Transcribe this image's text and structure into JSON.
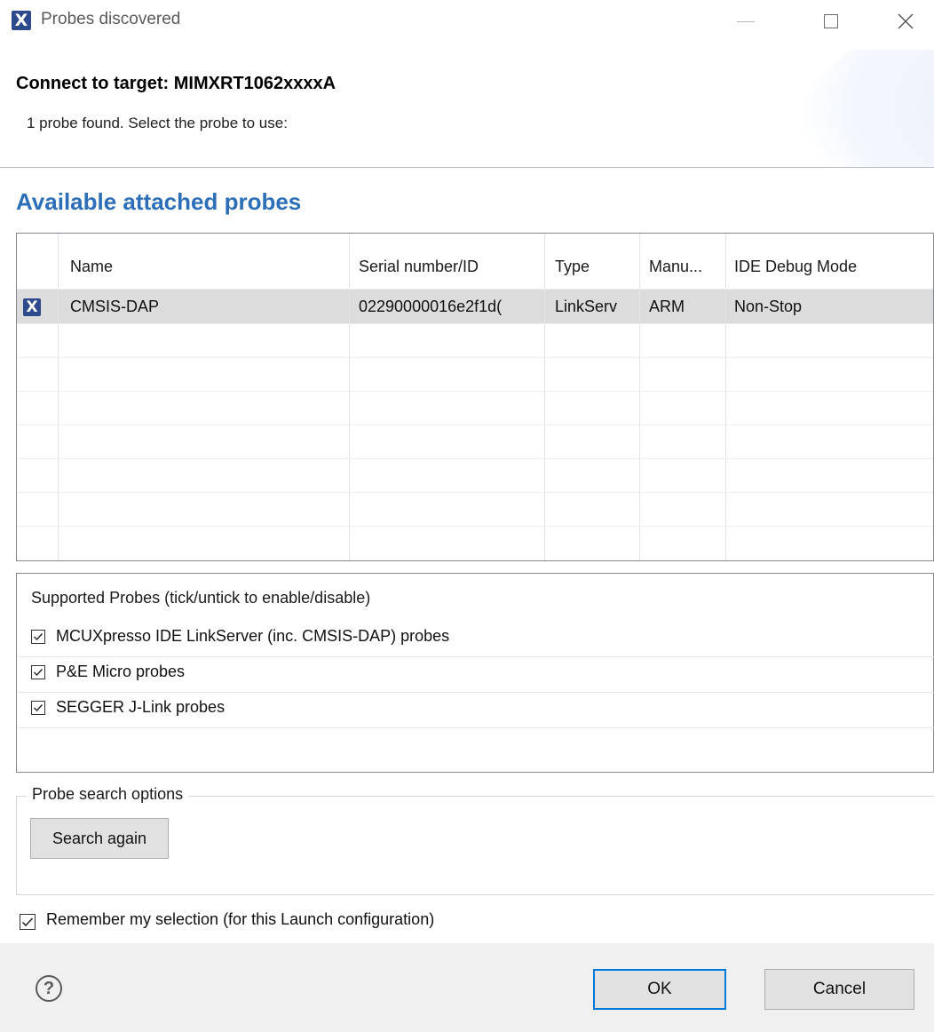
{
  "window": {
    "title": "Probes discovered",
    "app_icon_glyph": "X"
  },
  "header": {
    "title": "Connect to target: MIMXRT1062xxxxA",
    "description": "1 probe found. Select the probe to use:"
  },
  "probes_section": {
    "heading": "Available attached probes",
    "columns": [
      "Name",
      "Serial number/ID",
      "Type",
      "Manu...",
      "IDE Debug Mode"
    ],
    "rows": [
      {
        "icon": "probe-icon",
        "icon_glyph": "X",
        "name": "CMSIS-DAP",
        "serial": "02290000016e2f1d(",
        "type": "LinkServ",
        "manufacturer": "ARM",
        "debug_mode": "Non-Stop",
        "selected": true
      }
    ]
  },
  "supported_probes": {
    "label": "Supported Probes (tick/untick to enable/disable)",
    "items": [
      {
        "label": "MCUXpresso IDE LinkServer (inc. CMSIS-DAP) probes",
        "checked": true
      },
      {
        "label": "P&E Micro probes",
        "checked": true
      },
      {
        "label": "SEGGER J-Link probes",
        "checked": true
      }
    ]
  },
  "search_options": {
    "legend": "Probe search options",
    "search_button": "Search again"
  },
  "remember": {
    "label": "Remember my selection (for this Launch configuration)",
    "checked": true
  },
  "footer": {
    "help_glyph": "?",
    "ok_label": "OK",
    "cancel_label": "Cancel"
  },
  "colors": {
    "heading_blue": "#2c6fb8",
    "icon_navy": "#2f4a8c",
    "selection_gray": "#dcdcdc",
    "default_button_border": "#0078d7"
  }
}
